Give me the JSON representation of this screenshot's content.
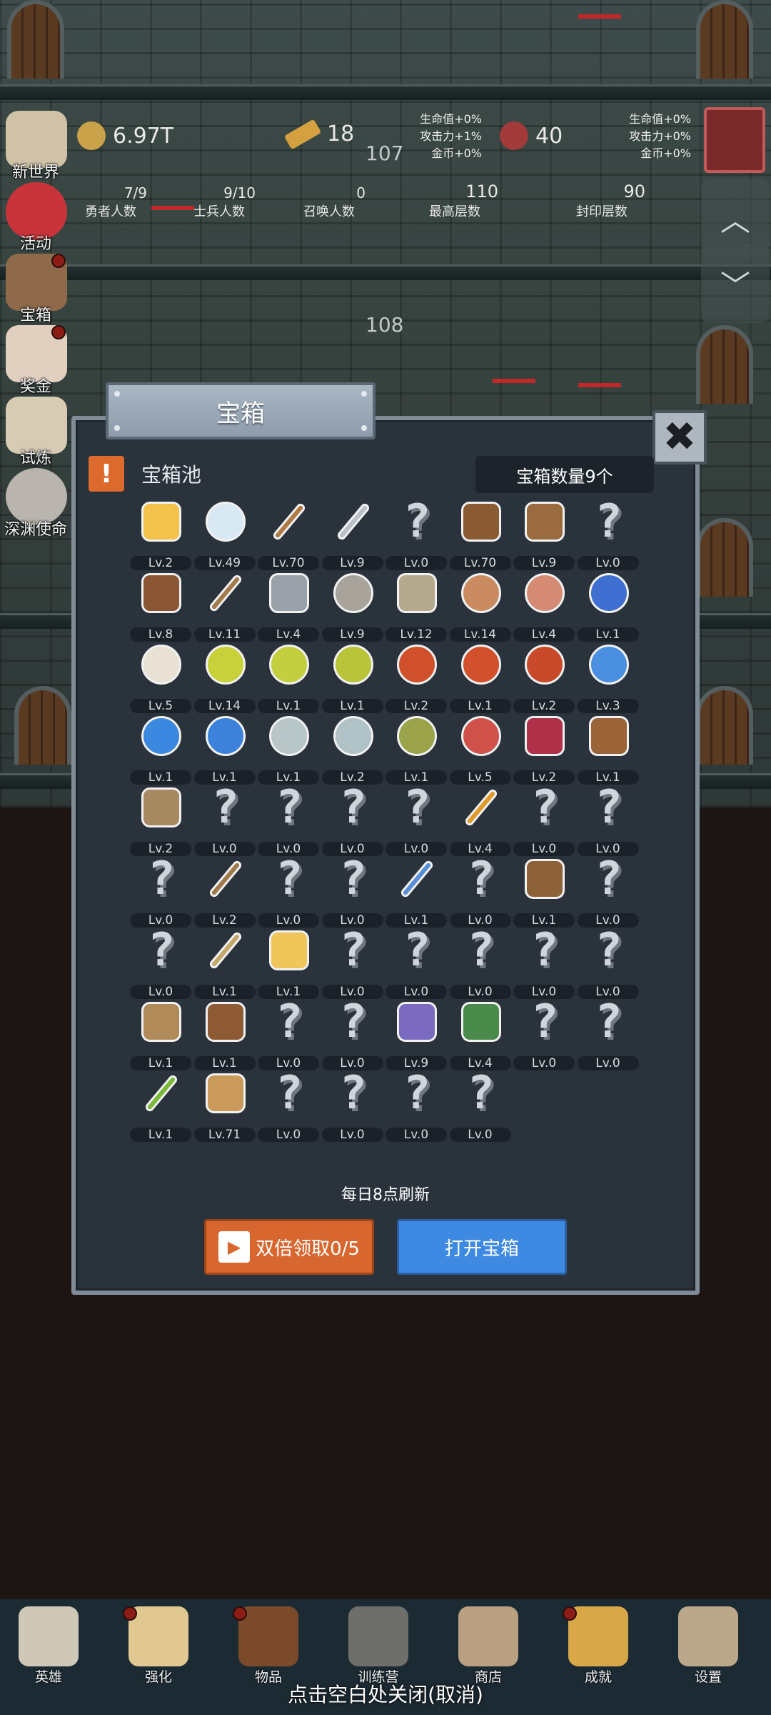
{
  "floors": {
    "upper": "107",
    "lower": "108"
  },
  "resources": {
    "gold": "6.97T",
    "ingots": "18",
    "meat": "40"
  },
  "bonuses_left": {
    "hp": "生命值+0%",
    "atk": "攻击力+1%",
    "gold": "金币+0%"
  },
  "bonuses_right": {
    "hp": "生命值+0%",
    "atk": "攻击力+0%",
    "gold": "金币+0%"
  },
  "counts": [
    {
      "value": "7/9",
      "label": "勇者人数"
    },
    {
      "value": "9/10",
      "label": "士兵人数"
    },
    {
      "value": "0",
      "label": "召唤人数"
    },
    {
      "value": "110",
      "label": "最高层数"
    },
    {
      "value": "90",
      "label": "封印层数"
    }
  ],
  "side_menu": [
    "新世界",
    "活动",
    "宝箱",
    "奖金",
    "试炼",
    "深渊使命"
  ],
  "modal": {
    "title": "宝箱",
    "pool_label": "宝箱池",
    "chest_count": "宝箱数量9个",
    "refresh_note": "每日8点刷新",
    "double_button": "双倍领取0/5",
    "open_button": "打开宝箱"
  },
  "items": [
    {
      "icon": "crown-icon",
      "color": "#f2c24a",
      "lv": "Lv.2"
    },
    {
      "icon": "diamond-icon",
      "color": "#d9e9f3",
      "lv": "Lv.49"
    },
    {
      "icon": "wooden-sword-icon",
      "color": "#b07a45",
      "lv": "Lv.70"
    },
    {
      "icon": "sword-icon",
      "color": "#b9c0c8",
      "lv": "Lv.9"
    },
    {
      "icon": "unknown-icon",
      "color": "",
      "lv": "Lv.0"
    },
    {
      "icon": "leather-armor-icon",
      "color": "#8a5a32",
      "lv": "Lv.70"
    },
    {
      "icon": "backpack-icon",
      "color": "#9a6b3f",
      "lv": "Lv.9"
    },
    {
      "icon": "unknown-icon",
      "color": "",
      "lv": "Lv.0"
    },
    {
      "icon": "leather-helmet-icon",
      "color": "#8a5634",
      "lv": "Lv.8"
    },
    {
      "icon": "dagger-icon",
      "color": "#a47a4c",
      "lv": "Lv.11"
    },
    {
      "icon": "iron-helmet-icon",
      "color": "#9aa1a8",
      "lv": "Lv.4"
    },
    {
      "icon": "hammer-icon",
      "color": "#a7a39b",
      "lv": "Lv.9"
    },
    {
      "icon": "great-helm-icon",
      "color": "#b5a98e",
      "lv": "Lv.12"
    },
    {
      "icon": "ham-icon",
      "color": "#c98b5f",
      "lv": "Lv.14"
    },
    {
      "icon": "steak-icon",
      "color": "#d48a73",
      "lv": "Lv.4"
    },
    {
      "icon": "blue-bag-icon",
      "color": "#3f6fd1",
      "lv": "Lv.1"
    },
    {
      "icon": "flour-bowl-icon",
      "color": "#e8e1d4",
      "lv": "Lv.5"
    },
    {
      "icon": "yellow-potion-icon",
      "color": "#c9d13a",
      "lv": "Lv.14"
    },
    {
      "icon": "yellow-potion-icon",
      "color": "#c3cf3e",
      "lv": "Lv.1"
    },
    {
      "icon": "yellow-potion-icon",
      "color": "#b9c43a",
      "lv": "Lv.1"
    },
    {
      "icon": "red-potion-icon",
      "color": "#d1502c",
      "lv": "Lv.2"
    },
    {
      "icon": "red-potion-icon",
      "color": "#d2502c",
      "lv": "Lv.1"
    },
    {
      "icon": "red-potion-icon",
      "color": "#c94a2a",
      "lv": "Lv.2"
    },
    {
      "icon": "blue-potion-icon",
      "color": "#4a8fe0",
      "lv": "Lv.3"
    },
    {
      "icon": "blue-potion-icon",
      "color": "#3a88e0",
      "lv": "Lv.1"
    },
    {
      "icon": "blue-potion-icon",
      "color": "#3c82db",
      "lv": "Lv.1"
    },
    {
      "icon": "empty-bottle-icon",
      "color": "#b8c6c8",
      "lv": "Lv.1"
    },
    {
      "icon": "empty-bottle-icon",
      "color": "#b0c2c6",
      "lv": "Lv.2"
    },
    {
      "icon": "green-bottle-icon",
      "color": "#9aa24a",
      "lv": "Lv.1"
    },
    {
      "icon": "red-bottle-icon",
      "color": "#d0504a",
      "lv": "Lv.5"
    },
    {
      "icon": "winged-boot-icon",
      "color": "#b0304a",
      "lv": "Lv.2"
    },
    {
      "icon": "leather-boot-icon",
      "color": "#9a6438",
      "lv": "Lv.1"
    },
    {
      "icon": "shoe-icon",
      "color": "#a88a62",
      "lv": "Lv.2"
    },
    {
      "icon": "unknown-icon",
      "color": "",
      "lv": "Lv.0"
    },
    {
      "icon": "unknown-icon",
      "color": "",
      "lv": "Lv.0"
    },
    {
      "icon": "unknown-icon",
      "color": "",
      "lv": "Lv.0"
    },
    {
      "icon": "unknown-icon",
      "color": "",
      "lv": "Lv.0"
    },
    {
      "icon": "torch-icon",
      "color": "#e09a2a",
      "lv": "Lv.4"
    },
    {
      "icon": "unknown-icon",
      "color": "",
      "lv": "Lv.0"
    },
    {
      "icon": "unknown-icon",
      "color": "",
      "lv": "Lv.0"
    },
    {
      "icon": "unknown-icon",
      "color": "",
      "lv": "Lv.0"
    },
    {
      "icon": "staff-icon",
      "color": "#a07a4a",
      "lv": "Lv.2"
    },
    {
      "icon": "unknown-icon",
      "color": "",
      "lv": "Lv.0"
    },
    {
      "icon": "unknown-icon",
      "color": "",
      "lv": "Lv.0"
    },
    {
      "icon": "blue-wand-icon",
      "color": "#5a8fd8",
      "lv": "Lv.1"
    },
    {
      "icon": "unknown-icon",
      "color": "",
      "lv": "Lv.0"
    },
    {
      "icon": "big-backpack-icon",
      "color": "#8e6238",
      "lv": "Lv.1"
    },
    {
      "icon": "unknown-icon",
      "color": "",
      "lv": "Lv.0"
    },
    {
      "icon": "unknown-icon",
      "color": "",
      "lv": "Lv.0"
    },
    {
      "icon": "club-icon",
      "color": "#c4a86a",
      "lv": "Lv.1"
    },
    {
      "icon": "cheese-icon",
      "color": "#f0c65a",
      "lv": "Lv.1"
    },
    {
      "icon": "unknown-icon",
      "color": "",
      "lv": "Lv.0"
    },
    {
      "icon": "unknown-icon",
      "color": "",
      "lv": "Lv.0"
    },
    {
      "icon": "unknown-icon",
      "color": "",
      "lv": "Lv.0"
    },
    {
      "icon": "unknown-icon",
      "color": "",
      "lv": "Lv.0"
    },
    {
      "icon": "unknown-icon",
      "color": "",
      "lv": "Lv.0"
    },
    {
      "icon": "bow-icon",
      "color": "#b08a58",
      "lv": "Lv.1"
    },
    {
      "icon": "quiver-icon",
      "color": "#8e5a34",
      "lv": "Lv.1"
    },
    {
      "icon": "unknown-icon",
      "color": "",
      "lv": "Lv.0"
    },
    {
      "icon": "unknown-icon",
      "color": "",
      "lv": "Lv.0"
    },
    {
      "icon": "spellbook-icon",
      "color": "#7a6ac0",
      "lv": "Lv.9"
    },
    {
      "icon": "emblem-shield-icon",
      "color": "#4a8a4a",
      "lv": "Lv.4"
    },
    {
      "icon": "unknown-icon",
      "color": "",
      "lv": "Lv.0"
    },
    {
      "icon": "unknown-icon",
      "color": "",
      "lv": "Lv.0"
    },
    {
      "icon": "green-wand-icon",
      "color": "#7ab83a",
      "lv": "Lv.1"
    },
    {
      "icon": "beer-mug-icon",
      "color": "#c99a5a",
      "lv": "Lv.71"
    },
    {
      "icon": "unknown-icon",
      "color": "",
      "lv": "Lv.0"
    },
    {
      "icon": "unknown-icon",
      "color": "",
      "lv": "Lv.0"
    },
    {
      "icon": "unknown-icon",
      "color": "",
      "lv": "Lv.0"
    },
    {
      "icon": "unknown-icon",
      "color": "",
      "lv": "Lv.0"
    }
  ],
  "bottom_nav": [
    {
      "label": "英雄",
      "icon": "skull-icon",
      "color": "#cfc8b8",
      "badge": false
    },
    {
      "label": "强化",
      "icon": "candle-icon",
      "color": "#e0c890",
      "badge": true
    },
    {
      "label": "物品",
      "icon": "book-icon",
      "color": "#7a4a2a",
      "badge": true
    },
    {
      "label": "训练营",
      "icon": "lantern-icon",
      "color": "#6e6e6a",
      "badge": false
    },
    {
      "label": "商店",
      "icon": "tankard-icon",
      "color": "#b8a080",
      "badge": false
    },
    {
      "label": "成就",
      "icon": "key-icon",
      "color": "#d8a848",
      "badge": true
    },
    {
      "label": "设置",
      "icon": "cog-icon",
      "color": "#bba88a",
      "badge": false
    }
  ],
  "close_hint": "点击空白处关闭(取消)",
  "colors": {
    "accent_orange": "#d8672f",
    "accent_blue": "#3e8ae3",
    "panel": "#2a323c"
  }
}
